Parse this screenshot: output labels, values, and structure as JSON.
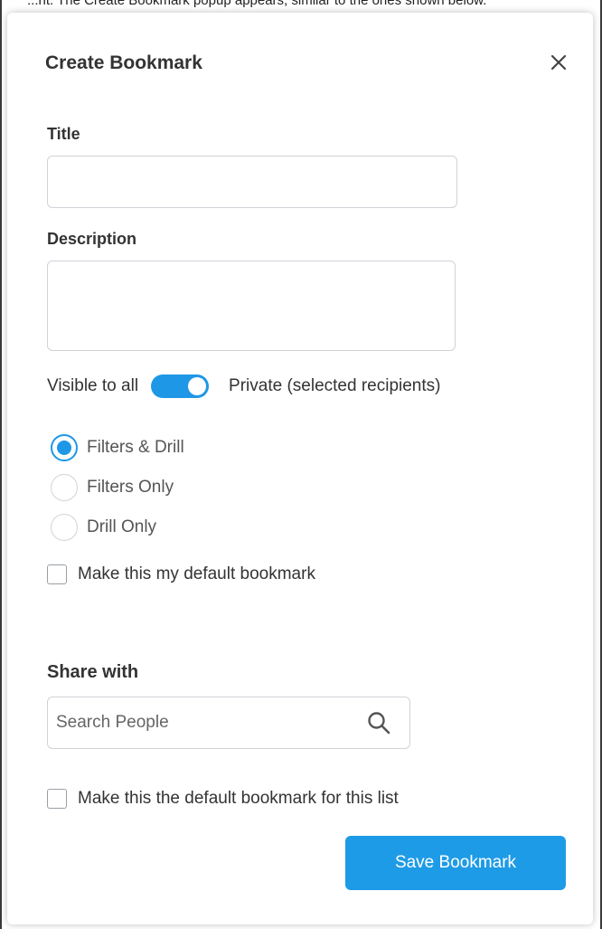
{
  "caption": "...nt. The Create Bookmark popup appears, similar to the ones shown below.",
  "dialog": {
    "title": "Create Bookmark",
    "close_icon": "close-icon"
  },
  "fields": {
    "title_label": "Title",
    "title_value": "",
    "description_label": "Description",
    "description_value": ""
  },
  "visibility": {
    "left_label": "Visible to all",
    "right_label": "Private (selected recipients)",
    "toggle_on": true
  },
  "options": {
    "items": [
      {
        "label": "Filters & Drill",
        "checked": true
      },
      {
        "label": "Filters Only",
        "checked": false
      },
      {
        "label": "Drill Only",
        "checked": false
      }
    ],
    "default_checkbox_label": "Make this my default bookmark",
    "default_checked": false
  },
  "share": {
    "label": "Share with",
    "search_placeholder": "Search People",
    "search_icon": "search-icon",
    "list_default_label": "Make this the default bookmark for this list",
    "list_default_checked": false
  },
  "actions": {
    "save_label": "Save Bookmark"
  },
  "colors": {
    "accent": "#1e97e6",
    "border": "#cfd3d8",
    "text": "#333333"
  }
}
